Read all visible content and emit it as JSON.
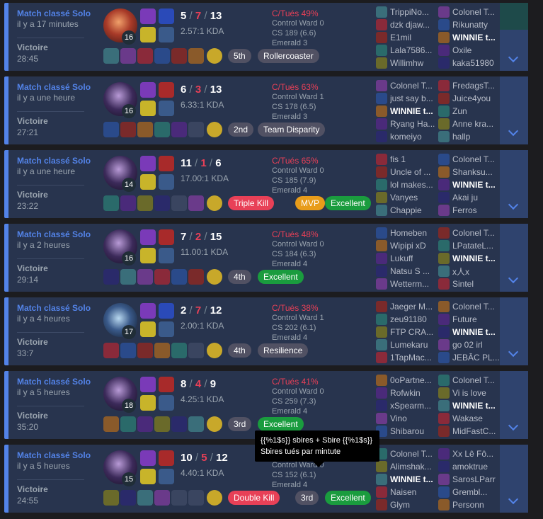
{
  "colors": {
    "accent": "#5383e8",
    "loss": "#e84057",
    "win_row": "#28344e"
  },
  "matches": [
    {
      "queue": "Match classé Solo",
      "ago": "il y a 17 minutes",
      "result": "Victoire",
      "duration": "28:45",
      "level": "16",
      "k": "5",
      "d": "7",
      "a": "13",
      "kda": "2.57:1 KDA",
      "pkill": "C/Tués 49%",
      "ward": "Control Ward 0",
      "cs": "CS 189 (6.6)",
      "rank": "Emerald 3",
      "badges": [
        {
          "label": "5th",
          "type": "grey"
        },
        {
          "label": "Rollercoaster",
          "type": "grey"
        }
      ],
      "team1": [
        "TrippiNo...",
        "dzk djaw...",
        "E1mil",
        "Lala7586...",
        "Willimhw"
      ],
      "team2": [
        "Colonel T...",
        "Rikunatty",
        "WINNIE t...",
        "Oxile",
        "kaka51980"
      ],
      "me": "2-2"
    },
    {
      "queue": "Match classé Solo",
      "ago": "il y a une heure",
      "result": "Victoire",
      "duration": "27:21",
      "level": "16",
      "k": "6",
      "d": "3",
      "a": "13",
      "kda": "6.33:1 KDA",
      "pkill": "C/Tués 63%",
      "ward": "Control Ward 1",
      "cs": "CS 178 (6.5)",
      "rank": "Emerald 3",
      "badges": [
        {
          "label": "2nd",
          "type": "grey"
        },
        {
          "label": "Team Disparity",
          "type": "grey"
        }
      ],
      "team1": [
        "Colonel T...",
        "just say b...",
        "WINNIE t...",
        "Ryang Ha...",
        "komeiyo"
      ],
      "team2": [
        "FredagsT...",
        "Juice4you",
        "Zun",
        "Anne kra...",
        "hallp"
      ],
      "me": "1-2"
    },
    {
      "queue": "Match classé Solo",
      "ago": "il y a une heure",
      "result": "Victoire",
      "duration": "23:22",
      "level": "14",
      "k": "11",
      "d": "1",
      "a": "6",
      "kda": "17.00:1 KDA",
      "pkill": "C/Tués 65%",
      "ward": "Control Ward 0",
      "cs": "CS 185 (7.9)",
      "rank": "Emerald 4",
      "badges": [
        {
          "label": "Triple Kill",
          "type": "red"
        },
        {
          "label": "MVP",
          "type": "orange"
        },
        {
          "label": "Excellent",
          "type": "green"
        }
      ],
      "team1": [
        "fis 1",
        "Uncle of ...",
        "lol makes...",
        "Vanyes",
        "Chappie"
      ],
      "team2": [
        "Colonel T...",
        "Shanksu...",
        "WINNIE t...",
        "Akai ju",
        "Ferros"
      ],
      "me": "2-2"
    },
    {
      "queue": "Match classé Solo",
      "ago": "il y a 2 heures",
      "result": "Victoire",
      "duration": "29:14",
      "level": "16",
      "k": "7",
      "d": "2",
      "a": "15",
      "kda": "11.00:1 KDA",
      "pkill": "C/Tués 48%",
      "ward": "Control Ward 0",
      "cs": "CS 184 (6.3)",
      "rank": "Emerald 4",
      "badges": [
        {
          "label": "4th",
          "type": "grey"
        },
        {
          "label": "Excellent",
          "type": "green"
        }
      ],
      "team1": [
        "Homeben",
        "Wipipi xD",
        "Lukuff",
        "Natsu S ...",
        "Wetterm..."
      ],
      "team2": [
        "Colonel T...",
        "LPatateL...",
        "WINNIE t...",
        "x人x",
        "Sintel"
      ],
      "me": "2-2"
    },
    {
      "queue": "Match classé Solo",
      "ago": "il y a 4 heures",
      "result": "Victoire",
      "duration": "33:7",
      "level": "17",
      "k": "2",
      "d": "7",
      "a": "12",
      "kda": "2.00:1 KDA",
      "pkill": "C/Tués 38%",
      "ward": "Control Ward 1",
      "cs": "CS 202 (6.1)",
      "rank": "Emerald 4",
      "badges": [
        {
          "label": "4th",
          "type": "grey"
        },
        {
          "label": "Resilience",
          "type": "grey"
        }
      ],
      "team1": [
        "Jaeger M...",
        "zeu91180",
        "FTP CRA...",
        "Lumekaru",
        "1TapMac..."
      ],
      "team2": [
        "Colonel T...",
        "Future",
        "WINNIE t...",
        "go 02 irl",
        "JEBĀC PL..."
      ],
      "me": "2-2"
    },
    {
      "queue": "Match classé Solo",
      "ago": "il y a 5 heures",
      "result": "Victoire",
      "duration": "35:20",
      "level": "18",
      "k": "8",
      "d": "4",
      "a": "9",
      "kda": "4.25:1 KDA",
      "pkill": "C/Tués 41%",
      "ward": "Control Ward 0",
      "cs": "CS 259 (7.3)",
      "rank": "Emerald 4",
      "badges": [
        {
          "label": "3rd",
          "type": "grey"
        },
        {
          "label": "Excellent",
          "type": "green"
        }
      ],
      "team1": [
        "0oPartne...",
        "Rofwkin",
        "xSpearm...",
        "Vino",
        "Shibarou"
      ],
      "team2": [
        "Colonel T...",
        "Vi is love",
        "WINNIE t...",
        "Wakase",
        "MidFastC..."
      ],
      "me": "2-2"
    },
    {
      "queue": "Match classé Solo",
      "ago": "il y a 5 heures",
      "result": "Victoire",
      "duration": "24:55",
      "level": "15",
      "k": "10",
      "d": "5",
      "a": "12",
      "kda": "4.40:1 KDA",
      "pkill": "C/Tués 63%",
      "ward": "Control Ward 0",
      "cs": "CS 152 (6.1)",
      "rank": "Emerald 4",
      "badges": [
        {
          "label": "Double Kill",
          "type": "red"
        },
        {
          "label": "3rd",
          "type": "grey"
        },
        {
          "label": "Excellent",
          "type": "green"
        }
      ],
      "team1": [
        "Colonel T...",
        "Alimshak...",
        "WINNIE t...",
        "Naisen",
        "Glym"
      ],
      "team2": [
        "Xx Lê Fô...",
        "amoktrue",
        "SarosLParr",
        "Grembl...",
        "Personn"
      ],
      "me": "1-2"
    }
  ],
  "tooltip": {
    "line1": "{{%1$s}} sbires + Sbire {{%1$s}}",
    "line2": "Sbires tués par mintute"
  }
}
